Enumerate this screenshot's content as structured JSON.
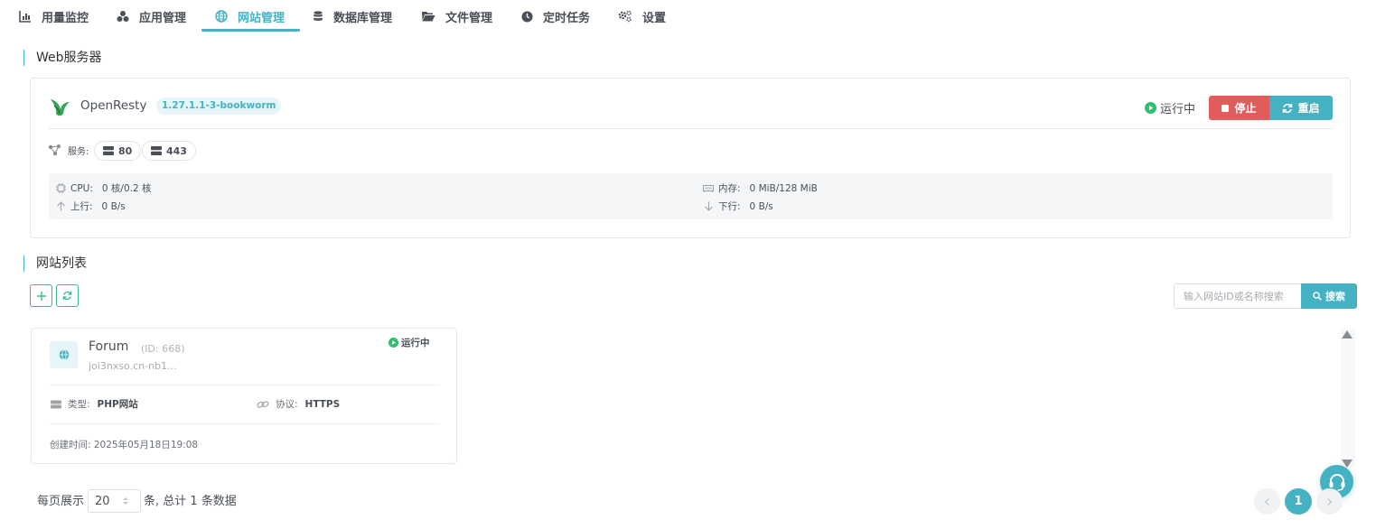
{
  "tabs": [
    {
      "label": "用量监控",
      "icon": "chart-icon"
    },
    {
      "label": "应用管理",
      "icon": "apps-icon"
    },
    {
      "label": "网站管理",
      "icon": "globe-icon",
      "active": true
    },
    {
      "label": "数据库管理",
      "icon": "database-icon"
    },
    {
      "label": "文件管理",
      "icon": "folder-icon"
    },
    {
      "label": "定时任务",
      "icon": "clock-icon"
    },
    {
      "label": "设置",
      "icon": "gears-icon"
    }
  ],
  "web_server": {
    "section_title": "Web服务器",
    "name": "OpenResty",
    "version": "1.27.1.1-3-bookworm",
    "status": "运行中",
    "stop_label": "停止",
    "restart_label": "重启",
    "services_label": "服务:",
    "ports": [
      "80",
      "443"
    ],
    "cpu_label": "CPU:",
    "cpu_value": "0 核/0.2 核",
    "mem_label": "内存:",
    "mem_value": "0 MiB/128 MiB",
    "up_label": "上行:",
    "up_value": "0 B/s",
    "down_label": "下行:",
    "down_value": "0 B/s"
  },
  "site_list": {
    "section_title": "网站列表",
    "search_placeholder": "输入网站ID或名称搜索",
    "search_label": "搜索",
    "sites": [
      {
        "name": "Forum",
        "id": "(ID: 668)",
        "domain": "joi3nxso.cn-nb1...",
        "status": "运行中",
        "type_label": "类型:",
        "type_value": "PHP网站",
        "protocol_label": "协议:",
        "protocol_value": "HTTPS",
        "created": "创建时间: 2025年05月18日19:08"
      }
    ]
  },
  "pagination": {
    "per_page_prefix": "每页展示",
    "per_page": "20",
    "summary": "条, 总计 1 条数据",
    "current_page": "1"
  },
  "colors": {
    "accent": "#44b2c2",
    "danger": "#e25c5c",
    "success": "#3cb98a",
    "running_dot": "#2fbf71"
  }
}
